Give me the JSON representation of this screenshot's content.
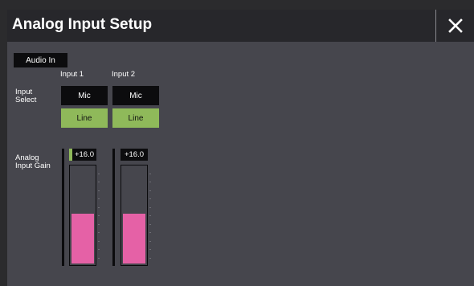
{
  "window": {
    "title": "Analog Input Setup"
  },
  "icons": {
    "close": "close-icon"
  },
  "audio_in_label": "Audio In",
  "input_select": {
    "label_line1": "Input",
    "label_line2": "Select",
    "columns": [
      "Input 1",
      "Input 2"
    ],
    "options": [
      "Mic",
      "Line"
    ],
    "selected": [
      "Line",
      "Line"
    ]
  },
  "gain": {
    "label_line1": "Analog",
    "label_line2": "Input Gain",
    "input1": {
      "value_text": "+16.0",
      "level": 0.52
    },
    "input2": {
      "value_text": "+16.0",
      "level": 0.52
    }
  },
  "colors": {
    "selected_button": "#8fb95a",
    "meter_fill": "#e561a6",
    "panel_background": "#46464d",
    "title_bar": "#27272b"
  }
}
